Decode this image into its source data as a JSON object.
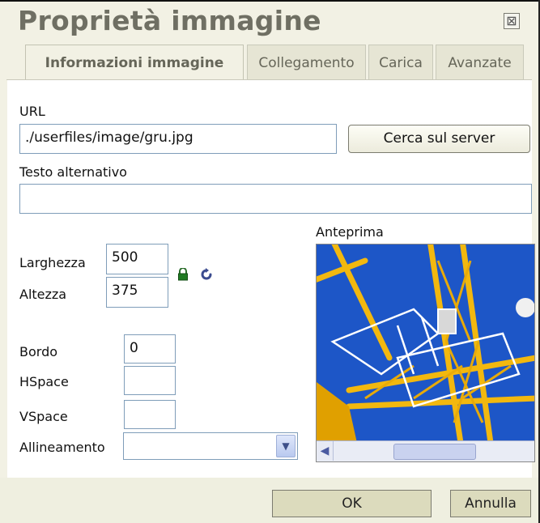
{
  "dialog": {
    "title": "Proprietà immagine",
    "close_label": "⊠"
  },
  "tabs": [
    {
      "label": "Informazioni immagine",
      "active": true
    },
    {
      "label": "Collegamento",
      "active": false
    },
    {
      "label": "Carica",
      "active": false
    },
    {
      "label": "Avanzate",
      "active": false
    }
  ],
  "form": {
    "url_label": "URL",
    "url_value": "./userfiles/image/gru.jpg",
    "browse_label": "Cerca sul server",
    "alt_label": "Testo alternativo",
    "alt_value": "",
    "width_label": "Larghezza",
    "width_value": "500",
    "height_label": "Altezza",
    "height_value": "375",
    "border_label": "Bordo",
    "border_value": "0",
    "hspace_label": "HSpace",
    "hspace_value": "",
    "vspace_label": "VSpace",
    "vspace_value": "",
    "align_label": "Allineamento",
    "align_value": ""
  },
  "preview": {
    "label": "Anteprima"
  },
  "footer": {
    "ok_label": "OK",
    "cancel_label": "Annulla"
  },
  "icons": {
    "lock": "lock-icon",
    "reset": "reset-size-icon"
  },
  "colors": {
    "dialog_bg": "#f2f1e4",
    "panel_bg": "#ffffff",
    "title": "#6f6f63",
    "sky": "#1d56c7",
    "crane": "#f2b80f"
  }
}
